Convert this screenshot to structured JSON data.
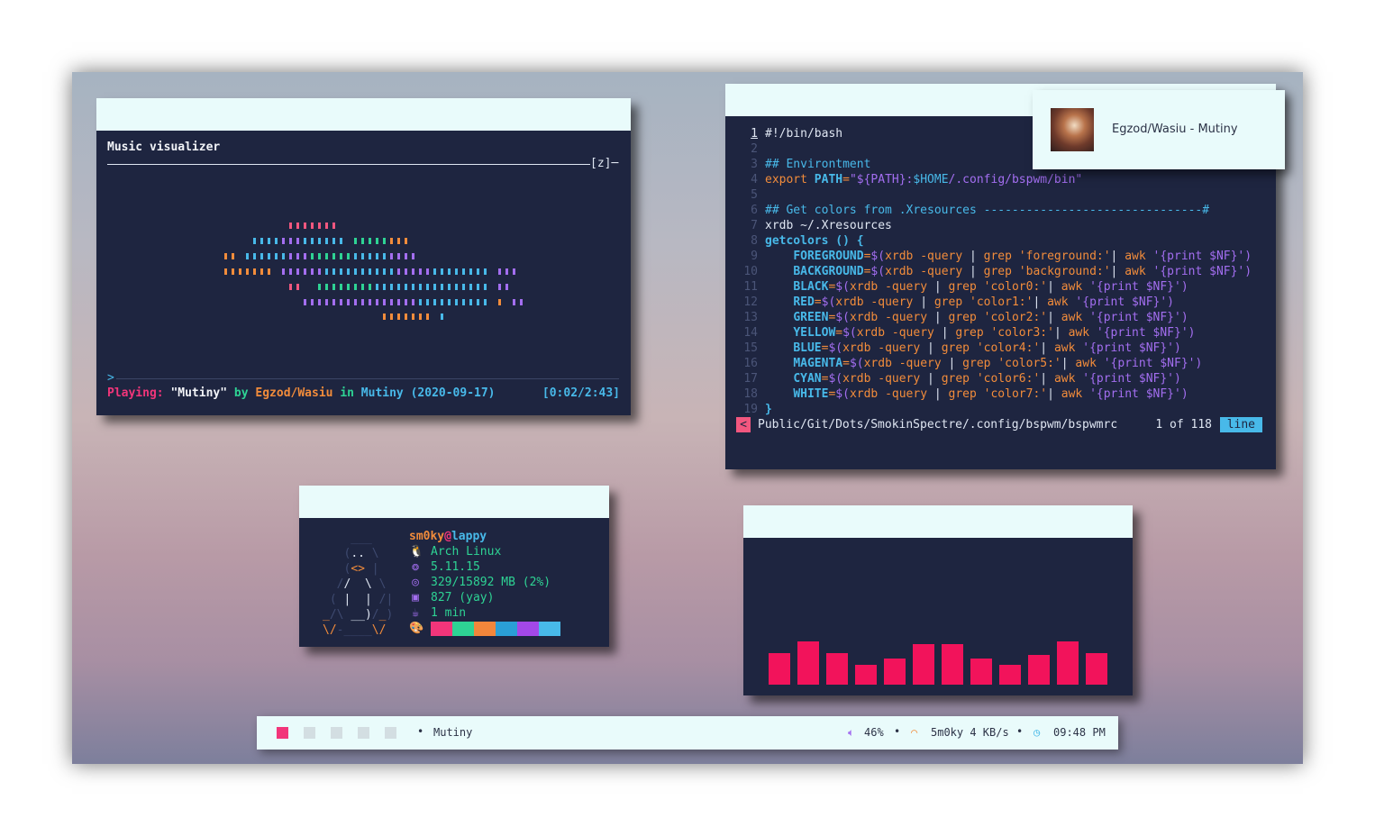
{
  "visualizer": {
    "title": "Music visualizer",
    "key_hint": "[z]─",
    "prompt": ">",
    "status": {
      "playing_label": "Playing:",
      "song": "\"Mutiny\"",
      "by": "by",
      "artist": "Egzod/Wasiu",
      "in": "in",
      "album": "Mutiny",
      "date": "(2020-09-17)",
      "time": "[0:02/2:43]"
    }
  },
  "editor": {
    "lines": [
      {
        "n": "1",
        "parts": [
          [
            "txt",
            "#!/bin/bash"
          ]
        ]
      },
      {
        "n": "2",
        "parts": []
      },
      {
        "n": "3",
        "parts": [
          [
            "com",
            "## Environtment"
          ]
        ]
      },
      {
        "n": "4",
        "parts": [
          [
            "key",
            "export "
          ],
          [
            "var",
            "PATH"
          ],
          [
            "op",
            "="
          ],
          [
            "str",
            "\"${PATH}:"
          ],
          [
            "com",
            "$HOME"
          ],
          [
            "str",
            "/.config/bspwm/bin\""
          ]
        ]
      },
      {
        "n": "5",
        "parts": []
      },
      {
        "n": "6",
        "parts": [
          [
            "com",
            "## Get colors from .Xresources -------------------------------#"
          ]
        ]
      },
      {
        "n": "7",
        "parts": [
          [
            "txt",
            "xrdb ~/.Xresources"
          ]
        ]
      },
      {
        "n": "8",
        "parts": [
          [
            "fn",
            "getcolors () {"
          ]
        ]
      },
      {
        "n": "9",
        "parts": [
          [
            "txt",
            "    "
          ],
          [
            "var",
            "FOREGROUND"
          ],
          [
            "op",
            "="
          ],
          [
            "str",
            "$("
          ],
          [
            "cmd",
            "xrdb -query "
          ],
          [
            "txt",
            "| "
          ],
          [
            "cmd",
            "grep "
          ],
          [
            "key",
            "'foreground:'"
          ],
          [
            "txt",
            "| "
          ],
          [
            "cmd",
            "awk "
          ],
          [
            "str",
            "'{print $NF}')"
          ]
        ]
      },
      {
        "n": "10",
        "parts": [
          [
            "txt",
            "    "
          ],
          [
            "var",
            "BACKGROUND"
          ],
          [
            "op",
            "="
          ],
          [
            "str",
            "$("
          ],
          [
            "cmd",
            "xrdb -query "
          ],
          [
            "txt",
            "| "
          ],
          [
            "cmd",
            "grep "
          ],
          [
            "key",
            "'background:'"
          ],
          [
            "txt",
            "| "
          ],
          [
            "cmd",
            "awk "
          ],
          [
            "str",
            "'{print $NF}')"
          ]
        ]
      },
      {
        "n": "11",
        "parts": [
          [
            "txt",
            "    "
          ],
          [
            "var",
            "BLACK"
          ],
          [
            "op",
            "="
          ],
          [
            "str",
            "$("
          ],
          [
            "cmd",
            "xrdb -query "
          ],
          [
            "txt",
            "| "
          ],
          [
            "cmd",
            "grep "
          ],
          [
            "key",
            "'color0:'"
          ],
          [
            "txt",
            "| "
          ],
          [
            "cmd",
            "awk "
          ],
          [
            "str",
            "'{print $NF}')"
          ]
        ]
      },
      {
        "n": "12",
        "parts": [
          [
            "txt",
            "    "
          ],
          [
            "var",
            "RED"
          ],
          [
            "op",
            "="
          ],
          [
            "str",
            "$("
          ],
          [
            "cmd",
            "xrdb -query "
          ],
          [
            "txt",
            "| "
          ],
          [
            "cmd",
            "grep "
          ],
          [
            "key",
            "'color1:'"
          ],
          [
            "txt",
            "| "
          ],
          [
            "cmd",
            "awk "
          ],
          [
            "str",
            "'{print $NF}')"
          ]
        ]
      },
      {
        "n": "13",
        "parts": [
          [
            "txt",
            "    "
          ],
          [
            "var",
            "GREEN"
          ],
          [
            "op",
            "="
          ],
          [
            "str",
            "$("
          ],
          [
            "cmd",
            "xrdb -query "
          ],
          [
            "txt",
            "| "
          ],
          [
            "cmd",
            "grep "
          ],
          [
            "key",
            "'color2:'"
          ],
          [
            "txt",
            "| "
          ],
          [
            "cmd",
            "awk "
          ],
          [
            "str",
            "'{print $NF}')"
          ]
        ]
      },
      {
        "n": "14",
        "parts": [
          [
            "txt",
            "    "
          ],
          [
            "var",
            "YELLOW"
          ],
          [
            "op",
            "="
          ],
          [
            "str",
            "$("
          ],
          [
            "cmd",
            "xrdb -query "
          ],
          [
            "txt",
            "| "
          ],
          [
            "cmd",
            "grep "
          ],
          [
            "key",
            "'color3:'"
          ],
          [
            "txt",
            "| "
          ],
          [
            "cmd",
            "awk "
          ],
          [
            "str",
            "'{print $NF}')"
          ]
        ]
      },
      {
        "n": "15",
        "parts": [
          [
            "txt",
            "    "
          ],
          [
            "var",
            "BLUE"
          ],
          [
            "op",
            "="
          ],
          [
            "str",
            "$("
          ],
          [
            "cmd",
            "xrdb -query "
          ],
          [
            "txt",
            "| "
          ],
          [
            "cmd",
            "grep "
          ],
          [
            "key",
            "'color4:'"
          ],
          [
            "txt",
            "| "
          ],
          [
            "cmd",
            "awk "
          ],
          [
            "str",
            "'{print $NF}')"
          ]
        ]
      },
      {
        "n": "16",
        "parts": [
          [
            "txt",
            "    "
          ],
          [
            "var",
            "MAGENTA"
          ],
          [
            "op",
            "="
          ],
          [
            "str",
            "$("
          ],
          [
            "cmd",
            "xrdb -query "
          ],
          [
            "txt",
            "| "
          ],
          [
            "cmd",
            "grep "
          ],
          [
            "key",
            "'color5:'"
          ],
          [
            "txt",
            "| "
          ],
          [
            "cmd",
            "awk "
          ],
          [
            "str",
            "'{print $NF}')"
          ]
        ]
      },
      {
        "n": "17",
        "parts": [
          [
            "txt",
            "    "
          ],
          [
            "var",
            "CYAN"
          ],
          [
            "op",
            "="
          ],
          [
            "str",
            "$("
          ],
          [
            "cmd",
            "xrdb -query "
          ],
          [
            "txt",
            "| "
          ],
          [
            "cmd",
            "grep "
          ],
          [
            "key",
            "'color6:'"
          ],
          [
            "txt",
            "| "
          ],
          [
            "cmd",
            "awk "
          ],
          [
            "str",
            "'{print $NF}')"
          ]
        ]
      },
      {
        "n": "18",
        "parts": [
          [
            "txt",
            "    "
          ],
          [
            "var",
            "WHITE"
          ],
          [
            "op",
            "="
          ],
          [
            "str",
            "$("
          ],
          [
            "cmd",
            "xrdb -query "
          ],
          [
            "txt",
            "| "
          ],
          [
            "cmd",
            "grep "
          ],
          [
            "key",
            "'color7:'"
          ],
          [
            "txt",
            "| "
          ],
          [
            "cmd",
            "awk "
          ],
          [
            "str",
            "'{print $NF}')"
          ]
        ]
      },
      {
        "n": "19",
        "parts": [
          [
            "fn",
            "}"
          ]
        ]
      }
    ],
    "statusline": {
      "left_marker": "<",
      "path": "Public/Git/Dots/SmokinSpectre/.config/bspwm/bspwmrc",
      "position": "1 of 118",
      "mode": "line"
    }
  },
  "notification": {
    "text": "Egzod/Wasiu - Mutiny"
  },
  "fetch": {
    "user": "sm0ky",
    "at": "@",
    "host": "lappy",
    "rows": [
      {
        "icon": "tux-icon",
        "glyph": "🐧",
        "value": "Arch Linux"
      },
      {
        "icon": "kernel-icon",
        "glyph": "❂",
        "value": "5.11.15"
      },
      {
        "icon": "memory-icon",
        "glyph": "◎",
        "value": "329/15892 MB (2%)"
      },
      {
        "icon": "package-icon",
        "glyph": "▣",
        "value": "827 (yay)"
      },
      {
        "icon": "uptime-icon",
        "glyph": "☕",
        "value": "1 min"
      }
    ],
    "palette": [
      "#f2357a",
      "#2ed394",
      "#f2863b",
      "#2a9fd6",
      "#a348e8",
      "#48b9e9"
    ]
  },
  "bars": {
    "values": [
      0.55,
      0.75,
      0.55,
      0.35,
      0.45,
      0.7,
      0.7,
      0.45,
      0.35,
      0.52,
      0.75,
      0.55
    ],
    "color": "#f2135b"
  },
  "panel": {
    "workspaces": [
      {
        "active": true,
        "color": "#f2357a"
      },
      {
        "active": false,
        "color": "#d3dee2"
      },
      {
        "active": false,
        "color": "#d3dee2"
      },
      {
        "active": false,
        "color": "#d3dee2"
      },
      {
        "active": false,
        "color": "#d3dee2"
      }
    ],
    "window_title": "Mutiny",
    "volume": "46%",
    "network": "5m0ky 4 KB/s",
    "clock": "09:48 PM"
  }
}
